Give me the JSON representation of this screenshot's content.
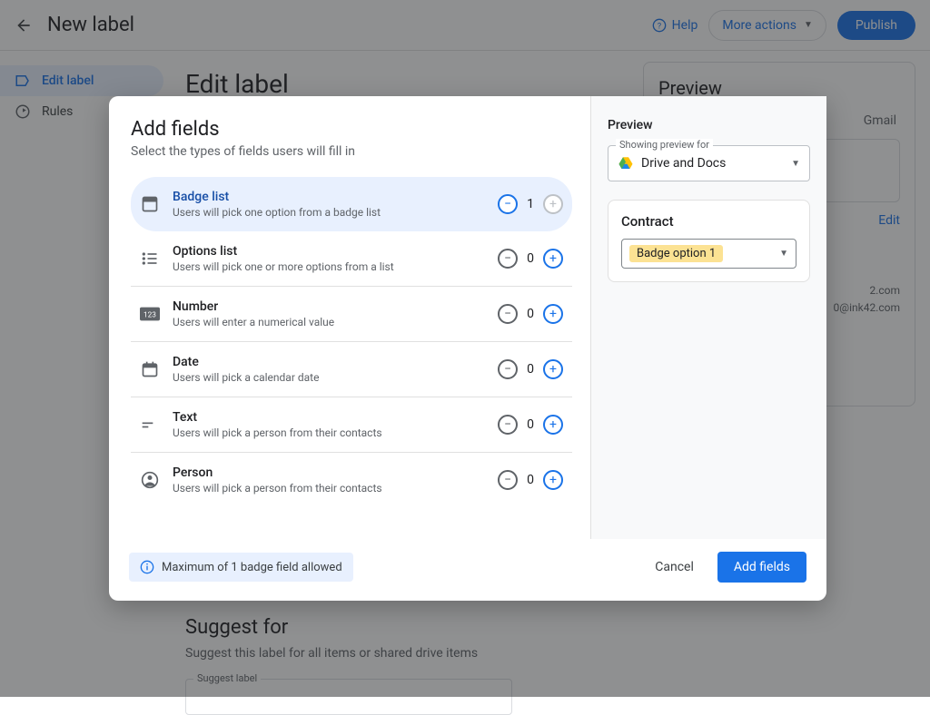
{
  "header": {
    "title": "New label",
    "help": "Help",
    "more_actions": "More actions",
    "publish": "Publish"
  },
  "sidebar": {
    "items": [
      {
        "label": "Edit label"
      },
      {
        "label": "Rules"
      }
    ]
  },
  "main": {
    "edit_label": "Edit label",
    "suggest_title": "Suggest for",
    "suggest_desc": "Suggest this label for all items or shared drive items",
    "suggest_legend": "Suggest label"
  },
  "bg_preview": {
    "title": "Preview",
    "tab": "Gmail",
    "edit": "Edit",
    "line1": "2.com",
    "line2": "0@ink42.com"
  },
  "modal": {
    "title": "Add fields",
    "subtitle": "Select the types of fields users will fill in",
    "fields": [
      {
        "name": "Badge list",
        "desc": "Users will pick one option from a badge list",
        "count": "1"
      },
      {
        "name": "Options list",
        "desc": "Users will pick one or more options from a list",
        "count": "0"
      },
      {
        "name": "Number",
        "desc": "Users will enter a numerical value",
        "count": "0"
      },
      {
        "name": "Date",
        "desc": "Users will pick a calendar date",
        "count": "0"
      },
      {
        "name": "Text",
        "desc": "Users will pick a person from their contacts",
        "count": "0"
      },
      {
        "name": "Person",
        "desc": "Users will pick a person from their contacts",
        "count": "0"
      }
    ],
    "info": "Maximum of 1 badge field allowed",
    "cancel": "Cancel",
    "add": "Add fields"
  },
  "modal_preview": {
    "title": "Preview",
    "legend": "Showing preview for",
    "selected": "Drive and Docs",
    "card_title": "Contract",
    "badge_option": "Badge option 1"
  }
}
